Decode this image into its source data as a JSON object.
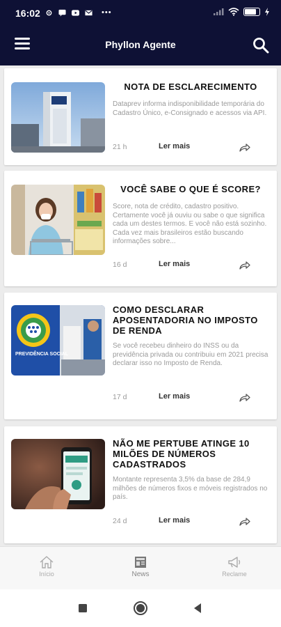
{
  "status_bar": {
    "time": "16:02",
    "dots": "•••",
    "battery_level": 0.8
  },
  "app_bar": {
    "title": "Phyllon Agente"
  },
  "feed": {
    "cards": [
      {
        "title": "NOTA DE ESCLARECIMENTO",
        "excerpt": "Dataprev informa indisponibilidade temporária do Cadastro Único, e-Consignado e acessos via API.",
        "age": "21 h",
        "read_more": "Ler mais"
      },
      {
        "title": "VOCÊ SABE O QUE É SCORE?",
        "excerpt": "Score, nota de crédito, cadastro positivo. Certamente você já ouviu ou sabe o que significa cada um destes termos. E você não está sozinho. Cada vez mais brasileiros estão buscando informações sobre...",
        "age": "16 d",
        "read_more": "Ler mais"
      },
      {
        "title": "COMO DESCLARAR APOSENTADORIA NO IMPOSTO DE RENDA",
        "excerpt": "Se você recebeu dinheiro do INSS ou da previdência privada ou contribuiu em 2021 precisa declarar isso no Imposto de Renda.",
        "age": "17 d",
        "read_more": "Ler mais",
        "image_label": "PREVIDÊNCIA SOCIAL"
      },
      {
        "title": "NÃO ME PERTUBE ATINGE 10 MILÕES DE NÚMEROS CADASTRADOS",
        "excerpt": "Montante representa 3,5% da base de 284,9 milhões de números fixos e móveis registrados no país.",
        "age": "24 d",
        "read_more": "Ler mais"
      }
    ]
  },
  "bottom_nav": {
    "items": [
      {
        "label": "Início",
        "icon": "home-icon"
      },
      {
        "label": "News",
        "icon": "newspaper-icon",
        "active": true
      },
      {
        "label": "Reclame",
        "icon": "megaphone-icon"
      }
    ]
  },
  "colors": {
    "primary": "#0e1135",
    "background": "#ececec",
    "card": "#ffffff",
    "muted_text": "#9a9a9a"
  }
}
